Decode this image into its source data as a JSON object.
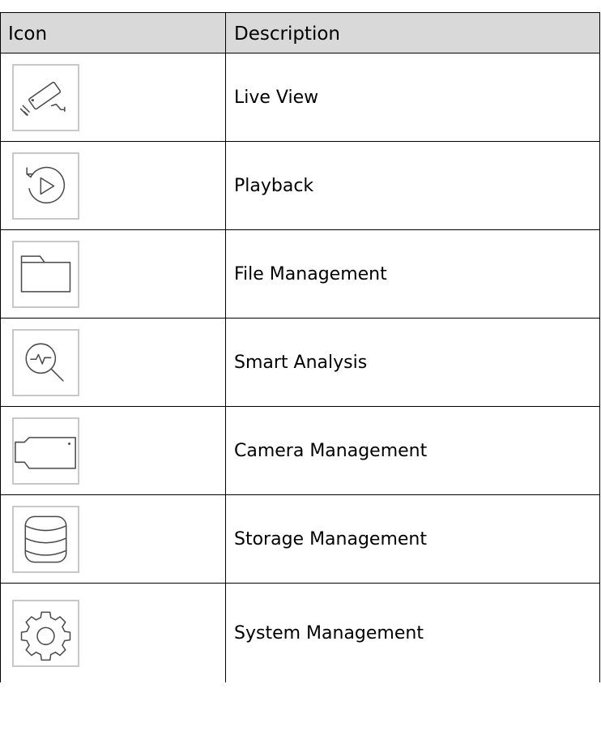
{
  "table": {
    "headers": {
      "icon": "Icon",
      "description": "Description"
    },
    "rows": [
      {
        "icon": "camera-icon",
        "description": "Live View"
      },
      {
        "icon": "playback-icon",
        "description": "Playback"
      },
      {
        "icon": "folder-icon",
        "description": "File Management"
      },
      {
        "icon": "smart-analysis-icon",
        "description": "Smart Analysis"
      },
      {
        "icon": "camera-management-icon",
        "description": "Camera Management"
      },
      {
        "icon": "storage-icon",
        "description": "Storage Management"
      },
      {
        "icon": "gear-icon",
        "description": "System Management"
      }
    ]
  },
  "colors": {
    "header_background": "#d9d9d9",
    "icon_stroke": "#4a4a4a",
    "icon_border": "#c8c8c8"
  }
}
